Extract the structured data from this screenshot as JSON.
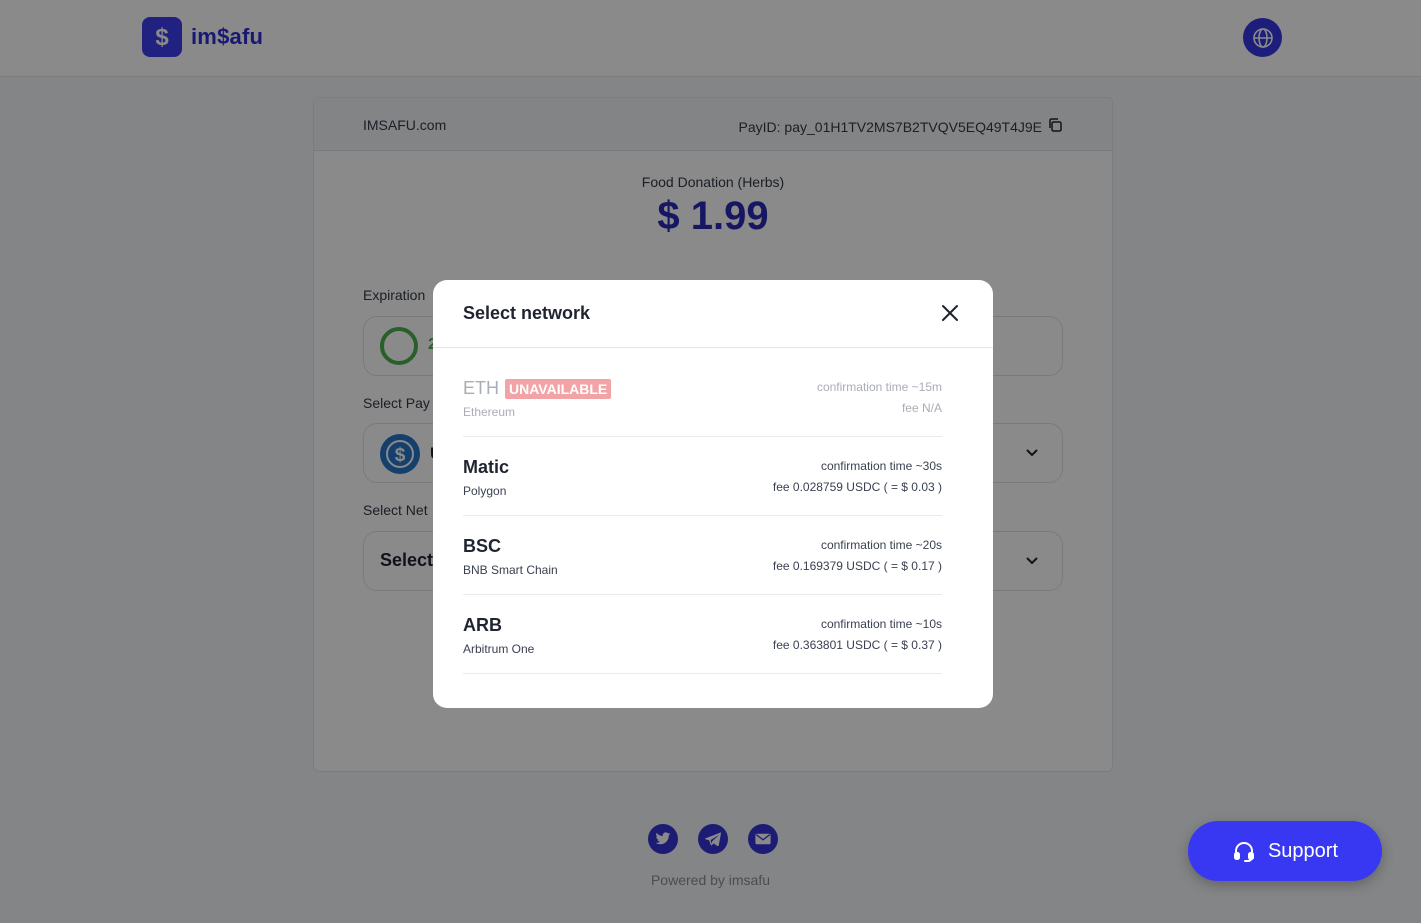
{
  "header": {
    "logo_text": "im$afu"
  },
  "card": {
    "merchant": "IMSAFU.com",
    "payid": "PayID: pay_01H1TV2MS7B2TVQV5EQ49T4J9E",
    "product": "Food Donation (Herbs)",
    "amount": "$ 1.99",
    "expiration_label": "Expiration",
    "timer_value": "2",
    "payment_label": "Select Pay",
    "coin_text": "U",
    "network_label": "Select Net",
    "network_placeholder": "Select"
  },
  "modal": {
    "title": "Select network",
    "networks": [
      {
        "code": "ETH",
        "badge": "UNAVAILABLE",
        "name": "Ethereum",
        "confirmation": "confirmation time ~15m",
        "fee": "fee N/A"
      },
      {
        "code": "Matic",
        "name": "Polygon",
        "confirmation": "confirmation time ~30s",
        "fee": "fee 0.028759 USDC ( = $ 0.03 )"
      },
      {
        "code": "BSC",
        "name": "BNB Smart Chain",
        "confirmation": "confirmation time ~20s",
        "fee": "fee 0.169379 USDC ( = $ 0.17 )"
      },
      {
        "code": "ARB",
        "name": "Arbitrum One",
        "confirmation": "confirmation time ~10s",
        "fee": "fee 0.363801 USDC ( = $ 0.37 )"
      }
    ]
  },
  "footer": {
    "powered_by": "Powered by imsafu",
    "social_icons": [
      "twitter-icon",
      "telegram-icon",
      "mail-icon"
    ]
  },
  "support": {
    "label": "Support"
  },
  "colors": {
    "brand": "#3838f2",
    "amount": "#2a2ab8",
    "timer": "#4caf50",
    "unavailable_badge": "#f2a3a5"
  }
}
